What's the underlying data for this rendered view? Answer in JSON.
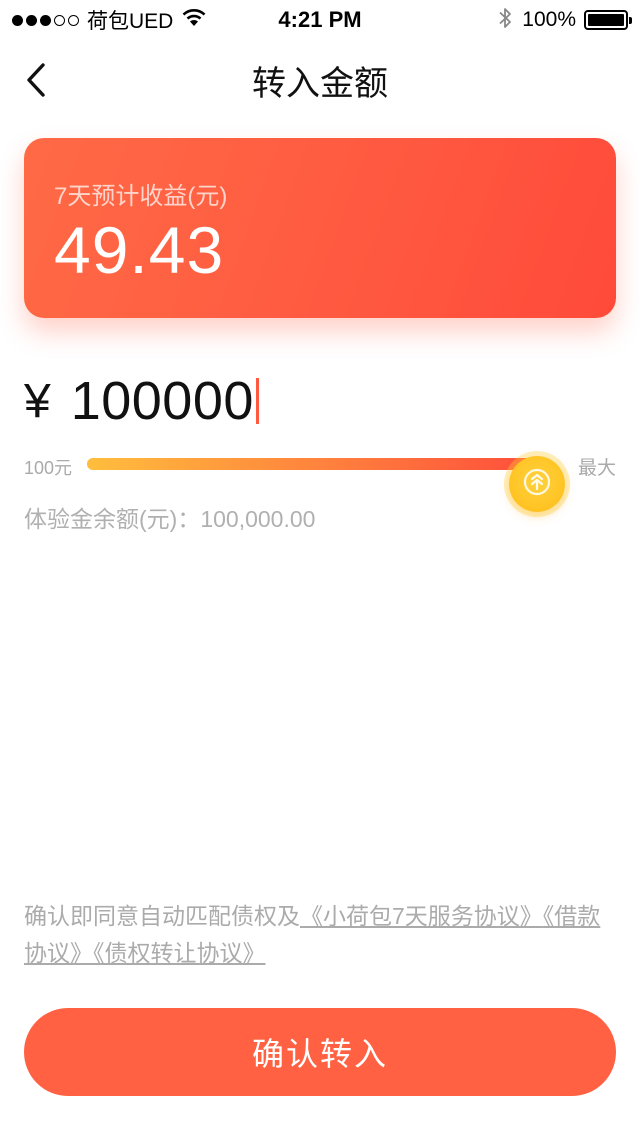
{
  "status_bar": {
    "carrier": "荷包UED",
    "time": "4:21 PM",
    "battery_text": "100%",
    "battery_level": 1.0,
    "signal_bars_filled": 3,
    "signal_bars_total": 5
  },
  "nav": {
    "title": "转入金额",
    "back_icon": "chevron-left-icon"
  },
  "earnings_card": {
    "label": "7天预计收益(元)",
    "value": "49.43",
    "accent": "#ff5a41"
  },
  "amount": {
    "currency": "¥",
    "value": "100000"
  },
  "slider": {
    "min_label": "100元",
    "max_label": "最大",
    "level": 1.0
  },
  "balance": {
    "label": "体验金余额(元)：",
    "value": "100,000.00"
  },
  "agreement": {
    "prefix": "确认即同意自动匹配债权及",
    "link1": "《小荷包7天服务协议》",
    "link2": "《借款协议》",
    "link3": "《债权转让协议》"
  },
  "confirm_button": {
    "label": "确认转入",
    "color": "#ff6142"
  }
}
